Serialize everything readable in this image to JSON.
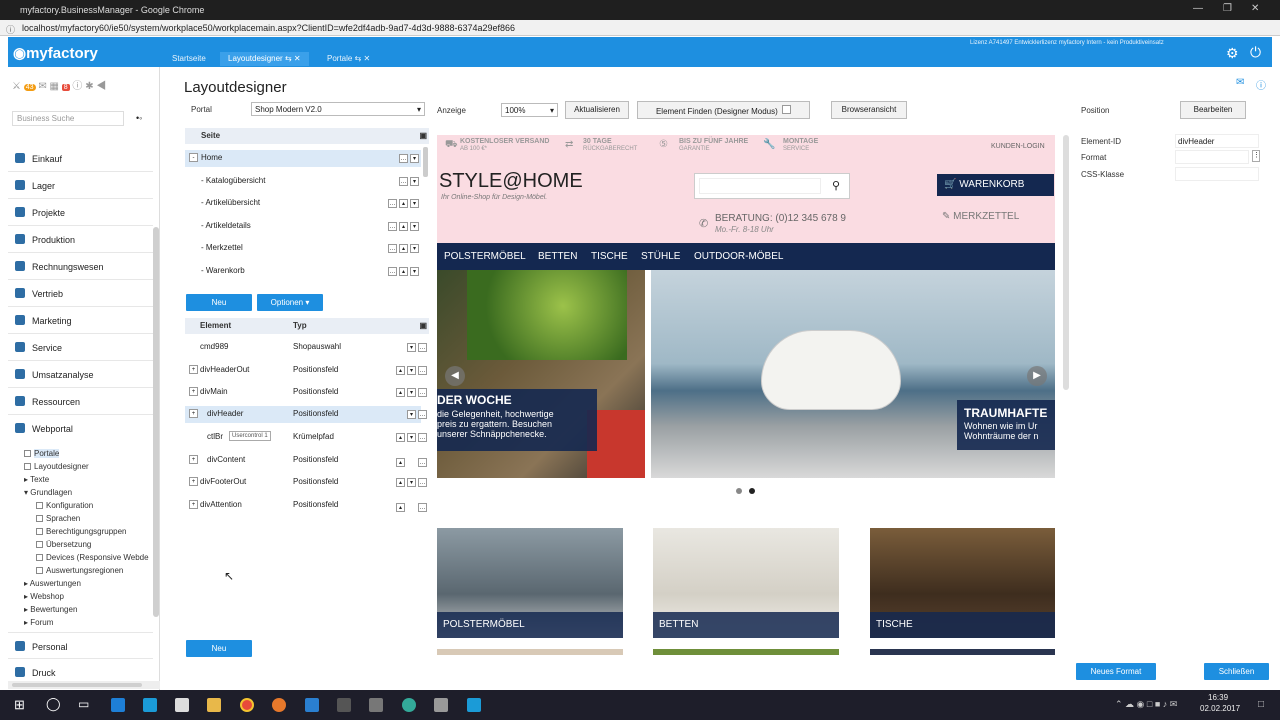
{
  "window": {
    "title": "myfactory.BusinessManager - Google Chrome"
  },
  "address": {
    "url": "localhost/myfactory60/ie50/system/workplace50/workplacemain.aspx?ClientID=wfe2df4adb-9ad7-4d3d-9888-6374a29ef866"
  },
  "app": {
    "logo": "myfactory",
    "tabs": [
      {
        "label": "Startseite"
      },
      {
        "label": "Layoutdesigner"
      },
      {
        "label": "Portale"
      }
    ],
    "license": "Lizenz A741497 Entwicklerlizenz myfactory Intern - kein Produktiveinsatz"
  },
  "sidebar": {
    "search_placeholder": "Business Suche",
    "badges": [
      "43",
      "8"
    ],
    "items": [
      {
        "label": "Einkauf"
      },
      {
        "label": "Lager"
      },
      {
        "label": "Projekte"
      },
      {
        "label": "Produktion"
      },
      {
        "label": "Rechnungswesen"
      },
      {
        "label": "Vertrieb"
      },
      {
        "label": "Marketing"
      },
      {
        "label": "Service"
      },
      {
        "label": "Umsatzanalyse"
      },
      {
        "label": "Ressourcen"
      },
      {
        "label": "Webportal"
      }
    ],
    "tree": [
      {
        "label": "Portale"
      },
      {
        "label": "Layoutdesigner"
      },
      {
        "label": "Texte"
      },
      {
        "label": "Grundlagen"
      },
      {
        "label": "Konfiguration"
      },
      {
        "label": "Sprachen"
      },
      {
        "label": "Berechtigungsgruppen"
      },
      {
        "label": "Übersetzung"
      },
      {
        "label": "Devices (Responsive Webde"
      },
      {
        "label": "Auswertungsregionen"
      },
      {
        "label": "Auswertungen"
      },
      {
        "label": "Webshop"
      },
      {
        "label": "Bewertungen"
      },
      {
        "label": "Forum"
      }
    ],
    "bottom_items": [
      {
        "label": "Personal"
      },
      {
        "label": "Druck"
      }
    ]
  },
  "page": {
    "title": "Layoutdesigner",
    "portal_label": "Portal",
    "portal_value": "Shop Modern V2.0",
    "anzeige_label": "Anzeige",
    "zoom_value": "100%",
    "refresh_button": "Aktualisieren",
    "find_button": "Element Finden (Designer Modus)",
    "browser_button": "Browseransicht"
  },
  "pages_table": {
    "header": "Seite",
    "rows": [
      {
        "label": "Home"
      },
      {
        "label": "- Katalogübersicht"
      },
      {
        "label": "- Artikelübersicht"
      },
      {
        "label": "- Artikeldetails"
      },
      {
        "label": "- Merkzettel"
      },
      {
        "label": "- Warenkorb"
      }
    ],
    "new_button": "Neu",
    "options_button": "Optionen"
  },
  "elements_table": {
    "col_element": "Element",
    "col_type": "Typ",
    "rows": [
      {
        "element": "cmd989",
        "type": "Shopauswahl"
      },
      {
        "element": "divHeaderOut",
        "type": "Positionsfeld"
      },
      {
        "element": "divMain",
        "type": "Positionsfeld"
      },
      {
        "element": "divHeader",
        "type": "Positionsfeld"
      },
      {
        "element": "ctlBr",
        "type": "Krümelpfad"
      },
      {
        "element": "divContent",
        "type": "Positionsfeld"
      },
      {
        "element": "divFooterOut",
        "type": "Positionsfeld"
      },
      {
        "element": "divAttention",
        "type": "Positionsfeld"
      }
    ],
    "tooltip": "Usercontrol 1",
    "new_button": "Neu"
  },
  "preview": {
    "topbar": [
      "KOSTENLOSER VERSAND",
      "AB 100 €*",
      "30 TAGE",
      "RÜCKGABERECHT",
      "BIS ZU FÜNF JAHRE",
      "GARANTIE",
      "MONTAGE",
      "SERVICE"
    ],
    "login": "KUNDEN-LOGIN",
    "logo": "STYLE@HOME",
    "slogan": "Ihr Online-Shop für Design-Möbel.",
    "phone": "BERATUNG: (0)12 345 678 9",
    "hours": "Mo.-Fr. 8-18 Uhr",
    "cart": "WARENKORB",
    "wishlist": "MERKZETTEL",
    "nav": [
      "POLSTERMÖBEL",
      "BETTEN",
      "TISCHE",
      "STÜHLE",
      "OUTDOOR-MÖBEL"
    ],
    "slide1_title": "DER WOCHE",
    "slide1_text1": "die Gelegenheit, hochwertige",
    "slide1_text2": "preis zu ergattern. Besuchen",
    "slide1_text3": "unserer Schnäppchenecke.",
    "slide2_title": "TRAUMHAFTE",
    "slide2_text1": "Wohnen wie im Ur",
    "slide2_text2": "Wohnträume der n",
    "tiles": [
      "POLSTERMÖBEL",
      "BETTEN",
      "TISCHE"
    ]
  },
  "properties": {
    "position_label": "Position",
    "edit_button": "Bearbeiten",
    "element_id_label": "Element-ID",
    "element_id_value": "divHeader",
    "format_label": "Format",
    "css_label": "CSS-Klasse",
    "new_format_button": "Neues Format",
    "close_button": "Schließen"
  },
  "taskbar": {
    "time": "16:39",
    "date": "02.02.2017"
  }
}
